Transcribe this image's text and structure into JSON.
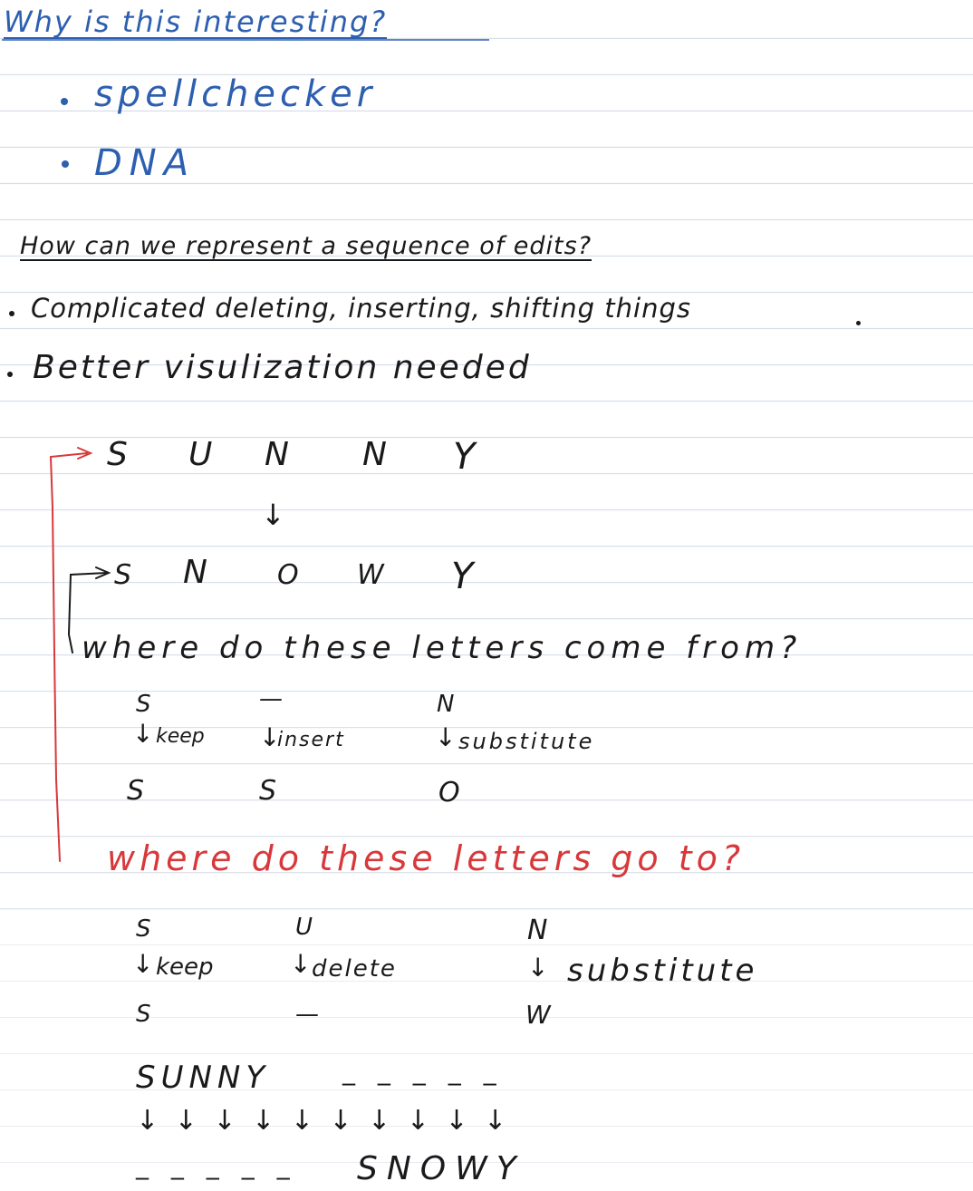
{
  "colors": {
    "blue_ink": "#2d5fb0",
    "black_ink": "#1a1a1a",
    "red_ink": "#d8383a",
    "rule_line": "#d6dee8"
  },
  "heading1": "Why is this interesting?",
  "bullets1": [
    "spellchecker",
    "DNA"
  ],
  "heading2": "How can we represent a sequence of edits?",
  "bullets2": [
    "Complicated deleting, inserting, shifting things",
    "Better visulization needed"
  ],
  "example": {
    "source_letters": [
      "S",
      "U",
      "N",
      "N",
      "Y"
    ],
    "target_letters": [
      "S",
      "N",
      "O",
      "W",
      "Y"
    ],
    "arrow_symbol": "↓"
  },
  "question_from": "where do these letters come from?",
  "from_ops": [
    {
      "top": "S",
      "label": "keep",
      "bottom": "S"
    },
    {
      "top": "—",
      "label": "insert",
      "bottom": "S"
    },
    {
      "top": "N",
      "label": "substitute",
      "bottom": "O"
    }
  ],
  "question_to": "where do these letters go to?",
  "to_ops": [
    {
      "top": "S",
      "label": "keep",
      "bottom": "S"
    },
    {
      "top": "U",
      "label": "delete",
      "bottom": "—"
    },
    {
      "top": "N",
      "label": "substitute",
      "bottom": "W"
    }
  ],
  "alignment": {
    "top_word": "SUNNY",
    "top_gaps": "_ _ _ _ _",
    "arrows": "↓ ↓ ↓ ↓ ↓   ↓ ↓ ↓ ↓ ↓",
    "bottom_gaps": "_ _ _ _ _",
    "bottom_word": "SNOWY"
  }
}
